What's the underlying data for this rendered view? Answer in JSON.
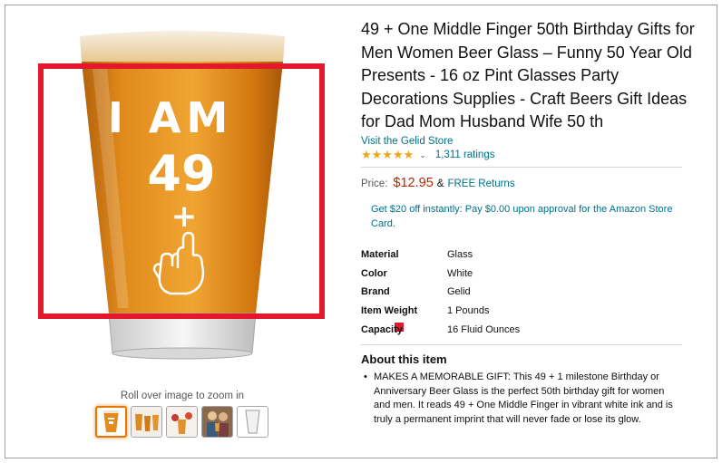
{
  "product": {
    "title": "49 + One Middle Finger 50th Birthday Gifts for Men Women Beer Glass – Funny 50 Year Old Presents - 16 oz Pint Glasses Party Decorations Supplies - Craft Beers Gift Ideas for Dad Mom Husband Wife 50 th",
    "store_link": "Visit the Gelid Store",
    "rating": {
      "stars": 4.5,
      "stars_glyphs": "★★★★★",
      "caret": "⌄",
      "ratings_count": "1,311 ratings"
    },
    "price": {
      "label": "Price:",
      "value": "$12.95",
      "amp": "&",
      "returns": "FREE Returns"
    },
    "promo": "Get $20 off instantly: Pay $0.00 upon approval for the Amazon Store Card.",
    "specs": [
      {
        "key": "Material",
        "value": "Glass"
      },
      {
        "key": "Color",
        "value": "White"
      },
      {
        "key": "Brand",
        "value": "Gelid"
      },
      {
        "key": "Item Weight",
        "value": "1 Pounds"
      },
      {
        "key": "Capacity",
        "value": "16 Fluid Ounces"
      }
    ],
    "about": {
      "heading": "About this item",
      "items": [
        "MAKES A MEMORABLE GIFT: This 49 + 1 milestone Birthday or Anniversary Beer Glass is the perfect 50th birthday gift for women and men. It reads 49 + One Middle Finger in vibrant white ink and is truly a permanent imprint that will never fade or lose its glow."
      ]
    }
  },
  "gallery": {
    "glass_print": {
      "line1": "I AM",
      "line2": "49",
      "line3": "+"
    },
    "zoom_hint": "Roll over image to zoom in",
    "thumbnails": [
      "thumb-beer-glass",
      "thumb-party",
      "thumb-party-2",
      "thumb-people",
      "thumb-empty-glass"
    ],
    "active_thumbnail": 0
  },
  "colors": {
    "link": "#007185",
    "price": "#b12704",
    "stars": "#f4a41c",
    "highlight": "#e3182d",
    "beer": "#d9851a",
    "active_thumb_border": "#e77600"
  }
}
